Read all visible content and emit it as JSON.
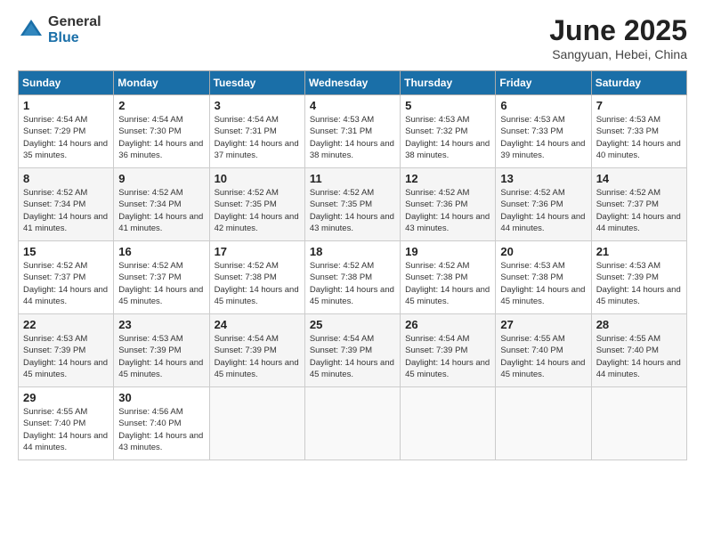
{
  "logo": {
    "general": "General",
    "blue": "Blue"
  },
  "title": "June 2025",
  "location": "Sangyuan, Hebei, China",
  "days_of_week": [
    "Sunday",
    "Monday",
    "Tuesday",
    "Wednesday",
    "Thursday",
    "Friday",
    "Saturday"
  ],
  "weeks": [
    [
      {
        "day": "1",
        "sunrise": "Sunrise: 4:54 AM",
        "sunset": "Sunset: 7:29 PM",
        "daylight": "Daylight: 14 hours and 35 minutes."
      },
      {
        "day": "2",
        "sunrise": "Sunrise: 4:54 AM",
        "sunset": "Sunset: 7:30 PM",
        "daylight": "Daylight: 14 hours and 36 minutes."
      },
      {
        "day": "3",
        "sunrise": "Sunrise: 4:54 AM",
        "sunset": "Sunset: 7:31 PM",
        "daylight": "Daylight: 14 hours and 37 minutes."
      },
      {
        "day": "4",
        "sunrise": "Sunrise: 4:53 AM",
        "sunset": "Sunset: 7:31 PM",
        "daylight": "Daylight: 14 hours and 38 minutes."
      },
      {
        "day": "5",
        "sunrise": "Sunrise: 4:53 AM",
        "sunset": "Sunset: 7:32 PM",
        "daylight": "Daylight: 14 hours and 38 minutes."
      },
      {
        "day": "6",
        "sunrise": "Sunrise: 4:53 AM",
        "sunset": "Sunset: 7:33 PM",
        "daylight": "Daylight: 14 hours and 39 minutes."
      },
      {
        "day": "7",
        "sunrise": "Sunrise: 4:53 AM",
        "sunset": "Sunset: 7:33 PM",
        "daylight": "Daylight: 14 hours and 40 minutes."
      }
    ],
    [
      {
        "day": "8",
        "sunrise": "Sunrise: 4:52 AM",
        "sunset": "Sunset: 7:34 PM",
        "daylight": "Daylight: 14 hours and 41 minutes."
      },
      {
        "day": "9",
        "sunrise": "Sunrise: 4:52 AM",
        "sunset": "Sunset: 7:34 PM",
        "daylight": "Daylight: 14 hours and 41 minutes."
      },
      {
        "day": "10",
        "sunrise": "Sunrise: 4:52 AM",
        "sunset": "Sunset: 7:35 PM",
        "daylight": "Daylight: 14 hours and 42 minutes."
      },
      {
        "day": "11",
        "sunrise": "Sunrise: 4:52 AM",
        "sunset": "Sunset: 7:35 PM",
        "daylight": "Daylight: 14 hours and 43 minutes."
      },
      {
        "day": "12",
        "sunrise": "Sunrise: 4:52 AM",
        "sunset": "Sunset: 7:36 PM",
        "daylight": "Daylight: 14 hours and 43 minutes."
      },
      {
        "day": "13",
        "sunrise": "Sunrise: 4:52 AM",
        "sunset": "Sunset: 7:36 PM",
        "daylight": "Daylight: 14 hours and 44 minutes."
      },
      {
        "day": "14",
        "sunrise": "Sunrise: 4:52 AM",
        "sunset": "Sunset: 7:37 PM",
        "daylight": "Daylight: 14 hours and 44 minutes."
      }
    ],
    [
      {
        "day": "15",
        "sunrise": "Sunrise: 4:52 AM",
        "sunset": "Sunset: 7:37 PM",
        "daylight": "Daylight: 14 hours and 44 minutes."
      },
      {
        "day": "16",
        "sunrise": "Sunrise: 4:52 AM",
        "sunset": "Sunset: 7:37 PM",
        "daylight": "Daylight: 14 hours and 45 minutes."
      },
      {
        "day": "17",
        "sunrise": "Sunrise: 4:52 AM",
        "sunset": "Sunset: 7:38 PM",
        "daylight": "Daylight: 14 hours and 45 minutes."
      },
      {
        "day": "18",
        "sunrise": "Sunrise: 4:52 AM",
        "sunset": "Sunset: 7:38 PM",
        "daylight": "Daylight: 14 hours and 45 minutes."
      },
      {
        "day": "19",
        "sunrise": "Sunrise: 4:52 AM",
        "sunset": "Sunset: 7:38 PM",
        "daylight": "Daylight: 14 hours and 45 minutes."
      },
      {
        "day": "20",
        "sunrise": "Sunrise: 4:53 AM",
        "sunset": "Sunset: 7:38 PM",
        "daylight": "Daylight: 14 hours and 45 minutes."
      },
      {
        "day": "21",
        "sunrise": "Sunrise: 4:53 AM",
        "sunset": "Sunset: 7:39 PM",
        "daylight": "Daylight: 14 hours and 45 minutes."
      }
    ],
    [
      {
        "day": "22",
        "sunrise": "Sunrise: 4:53 AM",
        "sunset": "Sunset: 7:39 PM",
        "daylight": "Daylight: 14 hours and 45 minutes."
      },
      {
        "day": "23",
        "sunrise": "Sunrise: 4:53 AM",
        "sunset": "Sunset: 7:39 PM",
        "daylight": "Daylight: 14 hours and 45 minutes."
      },
      {
        "day": "24",
        "sunrise": "Sunrise: 4:54 AM",
        "sunset": "Sunset: 7:39 PM",
        "daylight": "Daylight: 14 hours and 45 minutes."
      },
      {
        "day": "25",
        "sunrise": "Sunrise: 4:54 AM",
        "sunset": "Sunset: 7:39 PM",
        "daylight": "Daylight: 14 hours and 45 minutes."
      },
      {
        "day": "26",
        "sunrise": "Sunrise: 4:54 AM",
        "sunset": "Sunset: 7:39 PM",
        "daylight": "Daylight: 14 hours and 45 minutes."
      },
      {
        "day": "27",
        "sunrise": "Sunrise: 4:55 AM",
        "sunset": "Sunset: 7:40 PM",
        "daylight": "Daylight: 14 hours and 45 minutes."
      },
      {
        "day": "28",
        "sunrise": "Sunrise: 4:55 AM",
        "sunset": "Sunset: 7:40 PM",
        "daylight": "Daylight: 14 hours and 44 minutes."
      }
    ],
    [
      {
        "day": "29",
        "sunrise": "Sunrise: 4:55 AM",
        "sunset": "Sunset: 7:40 PM",
        "daylight": "Daylight: 14 hours and 44 minutes."
      },
      {
        "day": "30",
        "sunrise": "Sunrise: 4:56 AM",
        "sunset": "Sunset: 7:40 PM",
        "daylight": "Daylight: 14 hours and 43 minutes."
      },
      null,
      null,
      null,
      null,
      null
    ]
  ]
}
